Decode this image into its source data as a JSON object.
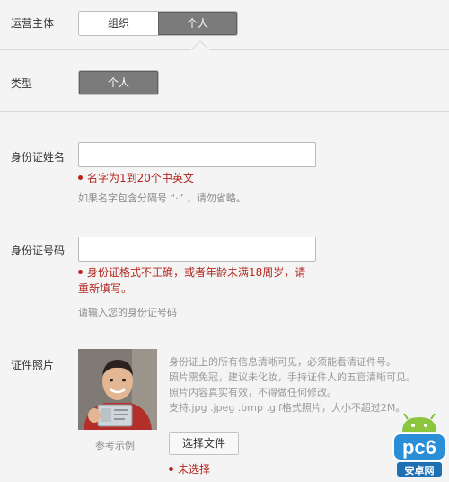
{
  "operator": {
    "label": "运营主体",
    "options": [
      "组织",
      "个人"
    ]
  },
  "type": {
    "label": "类型",
    "value": "个人"
  },
  "name": {
    "label": "身份证姓名",
    "value": "",
    "error": "名字为1到20个中英文",
    "hint": "如果名字包含分隔号 “·” ，请勿省略。"
  },
  "id_number": {
    "label": "身份证号码",
    "value": "",
    "error_line1": "身份证格式不正确，或者年龄未满18周岁，请",
    "error_line2": "重新填写。",
    "hint": "请输入您的身份证号码"
  },
  "photo": {
    "label": "证件照片",
    "example_caption": "参考示例",
    "tips": [
      "身份证上的所有信息清晰可见，必须能看清证件号。",
      "照片需免冠，建议未化妆，手持证件人的五官清晰可见。",
      "照片内容真实有效，不得做任何修改。",
      "支持.jpg .jpeg .bmp .gif格式照片，大小不超过2M。"
    ],
    "choose_button": "选择文件",
    "error": "未选择"
  },
  "watermark": {
    "text": "pc6",
    "sub": "安卓网"
  },
  "colors": {
    "active": "#7b7b7b",
    "error": "#b3261e",
    "watermark": "#2a8fd6"
  }
}
